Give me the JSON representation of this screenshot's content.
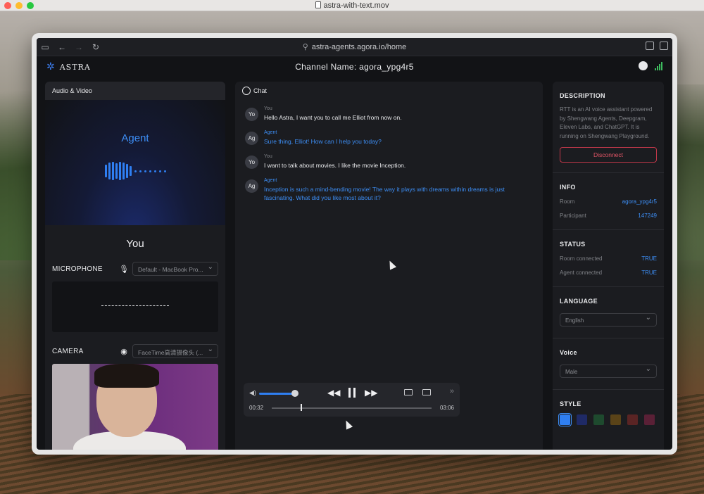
{
  "quicktime": {
    "filename": "astra-with-text.mov"
  },
  "browser": {
    "url": "astra-agents.agora.io/home"
  },
  "header": {
    "logo_text": "ASTRA",
    "channel_label": "Channel Name:",
    "channel_value": "agora_ypg4r5"
  },
  "left": {
    "title": "Audio & Video",
    "agent_label": "Agent",
    "you_label": "You",
    "microphone_label": "MICROPHONE",
    "microphone_device": "Default - MacBook Pro...",
    "camera_label": "CAMERA",
    "camera_device": "FaceTime高清摄像头 (..."
  },
  "chat": {
    "title": "Chat",
    "messages": [
      {
        "avatar": "Yo",
        "who": "You",
        "text": "Hello Astra, I want you to call me Elliot from now on.",
        "agent": false
      },
      {
        "avatar": "Ag",
        "who": "Agent",
        "text": "Sure thing, Elliot! How can I help you today?",
        "agent": true
      },
      {
        "avatar": "Yo",
        "who": "You",
        "text": "I want to talk about movies. I like the movie Inception.",
        "agent": false
      },
      {
        "avatar": "Ag",
        "who": "Agent",
        "text": "Inception is such a mind-bending movie! The way it plays with dreams within dreams is just fascinating. What did you like most about it?",
        "agent": true
      }
    ]
  },
  "player": {
    "current_time": "00:32",
    "total_time": "03:06",
    "progress": 0.18,
    "volume": 0.85
  },
  "right": {
    "description_title": "DESCRIPTION",
    "description_text": "RTT is an AI voice assistant powered by Shengwang Agents, Deepgram, Eleven Labs, and ChatGPT. It is running on Shengwang Playground.",
    "disconnect_label": "Disconnect",
    "info_title": "INFO",
    "room_label": "Room",
    "room_value": "agora_ypg4r5",
    "participant_label": "Participant",
    "participant_value": "147249",
    "status_title": "STATUS",
    "room_connected_label": "Room connected",
    "room_connected_value": "TRUE",
    "agent_connected_label": "Agent connected",
    "agent_connected_value": "TRUE",
    "language_title": "LANGUAGE",
    "language_value": "English",
    "voice_title": "Voice",
    "voice_value": "Male",
    "style_title": "STYLE",
    "style_colors": [
      "#2f7ff2",
      "#1f2a66",
      "#1e4a2e",
      "#5a4318",
      "#5a2424",
      "#5a2036"
    ]
  },
  "colors": {
    "accent": "#3d8ef5",
    "danger": "#e25566",
    "panel": "#1b1c20"
  }
}
